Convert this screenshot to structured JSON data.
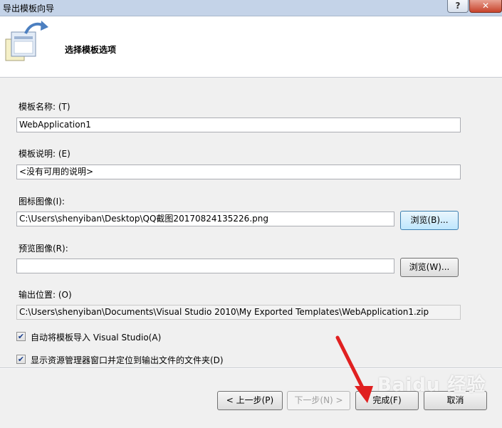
{
  "window": {
    "title": "导出模板向导",
    "help": "?",
    "close": "✕"
  },
  "header": {
    "heading": "选择模板选项"
  },
  "form": {
    "template_name_label": "模板名称: (T)",
    "template_name_value": "WebApplication1",
    "template_desc_label": "模板说明: (E)",
    "template_desc_value": "<没有可用的说明>",
    "icon_image_label": "图标图像(I):",
    "icon_image_value": "C:\\Users\\shenyiban\\Desktop\\QQ截图20170824135226.png",
    "icon_browse": "浏览(B)...",
    "preview_image_label": "预览图像(R):",
    "preview_image_value": "",
    "preview_browse": "浏览(W)...",
    "output_label": "输出位置: (O)",
    "output_value": "C:\\Users\\shenyiban\\Documents\\Visual Studio 2010\\My Exported Templates\\WebApplication1.zip",
    "auto_import_label": "自动将模板导入 Visual Studio(A)",
    "auto_import_checked": true,
    "show_explorer_label": "显示资源管理器窗口并定位到输出文件的文件夹(D)",
    "show_explorer_checked": true
  },
  "footer": {
    "back": "< 上一步(P)",
    "next": "下一步(N) >",
    "finish": "完成(F)",
    "cancel": "取消"
  },
  "overlay": {
    "watermark": "Baidu 经验"
  }
}
